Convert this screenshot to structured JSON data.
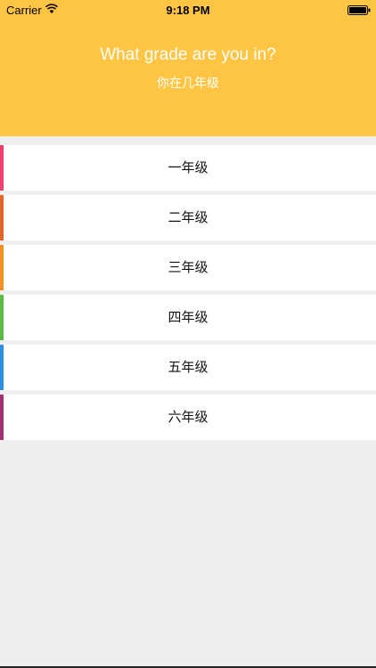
{
  "status_bar": {
    "carrier": "Carrier",
    "time": "9:18 PM",
    "wifi_icon": "wifi-icon",
    "battery_icon": "battery-icon"
  },
  "header": {
    "title": "What grade are you in?",
    "subtitle": "你在几年级",
    "background_color": "#fec444"
  },
  "grades": [
    {
      "label": "一年级",
      "accent_color": "#f0416e"
    },
    {
      "label": "二年级",
      "accent_color": "#e2652a"
    },
    {
      "label": "三年级",
      "accent_color": "#f38f26"
    },
    {
      "label": "四年级",
      "accent_color": "#5cba47"
    },
    {
      "label": "五年级",
      "accent_color": "#2f8fe0"
    },
    {
      "label": "六年级",
      "accent_color": "#a23177"
    }
  ]
}
